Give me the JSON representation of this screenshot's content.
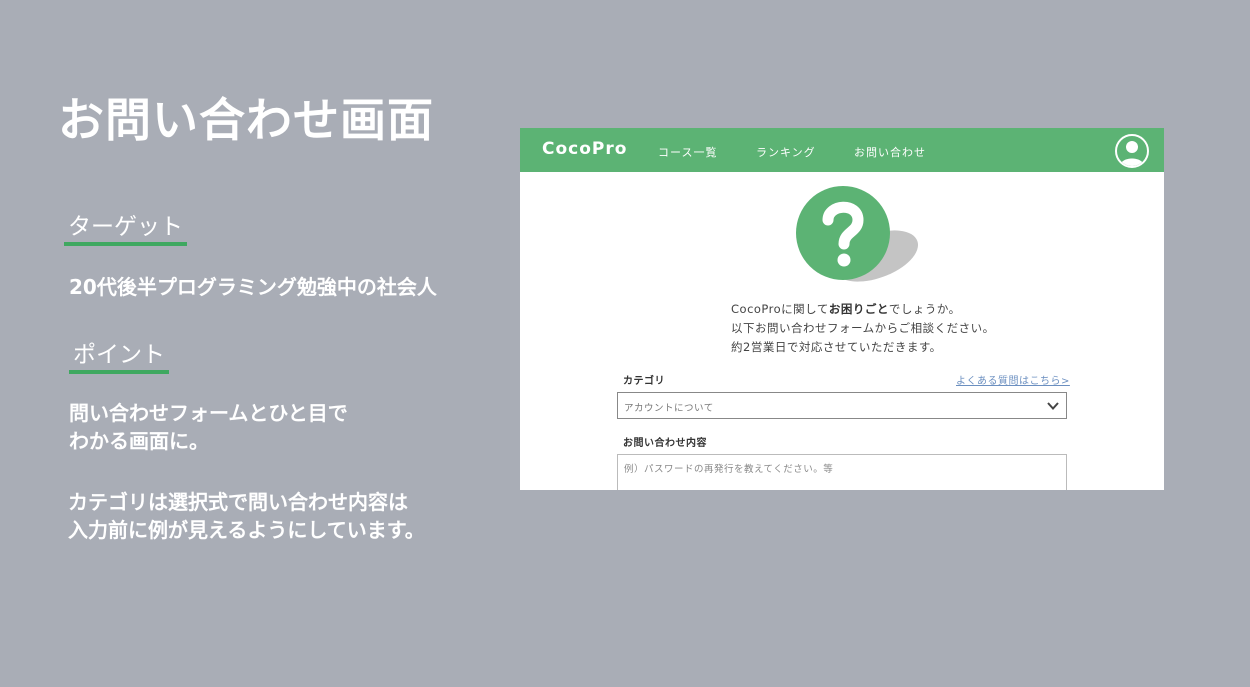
{
  "slide": {
    "title": "お問い合わせ画面",
    "target_heading": "ターゲット",
    "target_text": "20代後半プログラミング勉強中の社会人",
    "point_heading": "ポイント",
    "point_text_1": [
      "問い合わせフォームとひと目で",
      "わかる画面に。"
    ],
    "point_text_2": [
      "カテゴリは選択式で問い合わせ内容は",
      "入力前に例が見えるようにしています。"
    ]
  },
  "mockup": {
    "brand": "CocoPro",
    "nav": [
      "コース一覧",
      "ランキング",
      "お問い合わせ"
    ],
    "lead": {
      "line1_before": "CocoProに関して",
      "line1_strong": "お困りごと",
      "line1_after": "でしょうか。",
      "line2": "以下お問い合わせフォームからご相談ください。",
      "line3": "約2営業日で対応させていただきます。"
    },
    "category_label": "カテゴリ",
    "faq_link": "よくある質問はこちら>",
    "category_value": "アカウントについて",
    "content_label": "お問い合わせ内容",
    "content_placeholder": "例）パスワードの再発行を教えてください。等"
  },
  "colors": {
    "background": "#a9adb6",
    "brand_green": "#5cb374",
    "underline_green": "#3fa860",
    "link_blue": "#6b8fc0"
  },
  "icons": {
    "avatar": "user-avatar-icon",
    "question": "question-mark-icon",
    "dropdown": "chevron-down-icon"
  }
}
